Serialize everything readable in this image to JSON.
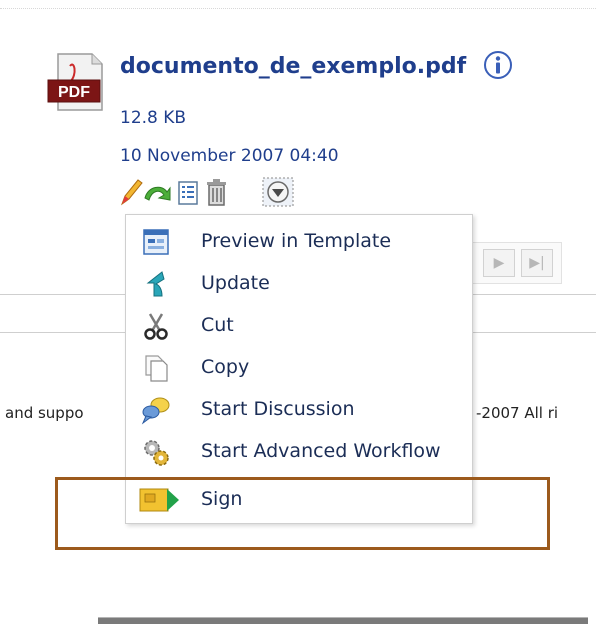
{
  "document": {
    "filename": "documento_de_exemplo.pdf",
    "size": "12.8 KB",
    "date": "10 November 2007 04:40",
    "icon": "pdf-file-icon",
    "pdf_badge": "PDF",
    "info_icon": "info-icon"
  },
  "actions": [
    {
      "icon": "pencil-edit-icon"
    },
    {
      "icon": "green-arrow-icon"
    },
    {
      "icon": "details-list-icon"
    },
    {
      "icon": "trash-icon"
    },
    {
      "icon": "dropdown-menu-icon"
    }
  ],
  "menu": {
    "items": [
      {
        "label": "Preview in Template",
        "icon": "template-preview-icon"
      },
      {
        "label": "Update",
        "icon": "update-arrow-icon"
      },
      {
        "label": "Cut",
        "icon": "scissors-icon"
      },
      {
        "label": "Copy",
        "icon": "copy-pages-icon"
      },
      {
        "label": "Start Discussion",
        "icon": "discussion-icon"
      },
      {
        "label": "Start Advanced Workflow",
        "icon": "workflow-gear-icon"
      },
      {
        "label": "Sign",
        "icon": "sign-card-icon"
      }
    ]
  },
  "background": {
    "footer_left": "and suppo",
    "footer_right": "-2007 All ri",
    "pager_next": "▶",
    "pager_last": "▶|"
  },
  "colors": {
    "link": "#1f3e8c",
    "highlight_border": "#9c5a1c"
  }
}
